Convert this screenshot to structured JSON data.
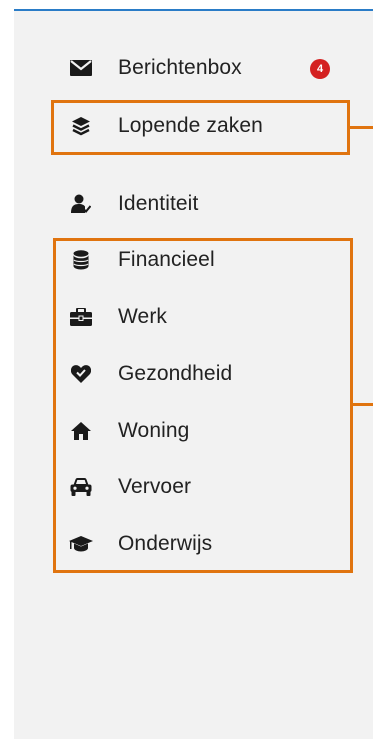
{
  "menu": {
    "items": [
      {
        "id": "berichtenbox",
        "label": "Berichtenbox",
        "icon": "envelope-icon"
      },
      {
        "id": "lopende-zaken",
        "label": "Lopende zaken",
        "icon": "layers-icon"
      },
      {
        "id": "identiteit",
        "label": "Identiteit",
        "icon": "user-check-icon"
      },
      {
        "id": "financieel",
        "label": "Financieel",
        "icon": "coins-icon"
      },
      {
        "id": "werk",
        "label": "Werk",
        "icon": "briefcase-icon"
      },
      {
        "id": "gezondheid",
        "label": "Gezondheid",
        "icon": "heart-icon"
      },
      {
        "id": "woning",
        "label": "Woning",
        "icon": "home-icon"
      },
      {
        "id": "vervoer",
        "label": "Vervoer",
        "icon": "car-icon"
      },
      {
        "id": "onderwijs",
        "label": "Onderwijs",
        "icon": "graduation-cap-icon"
      }
    ],
    "badge_count": "4"
  },
  "colors": {
    "accent_top": "#2a7cc7",
    "badge": "#d42121",
    "highlight": "#e0740f",
    "panel_bg": "#f2f2f2"
  }
}
